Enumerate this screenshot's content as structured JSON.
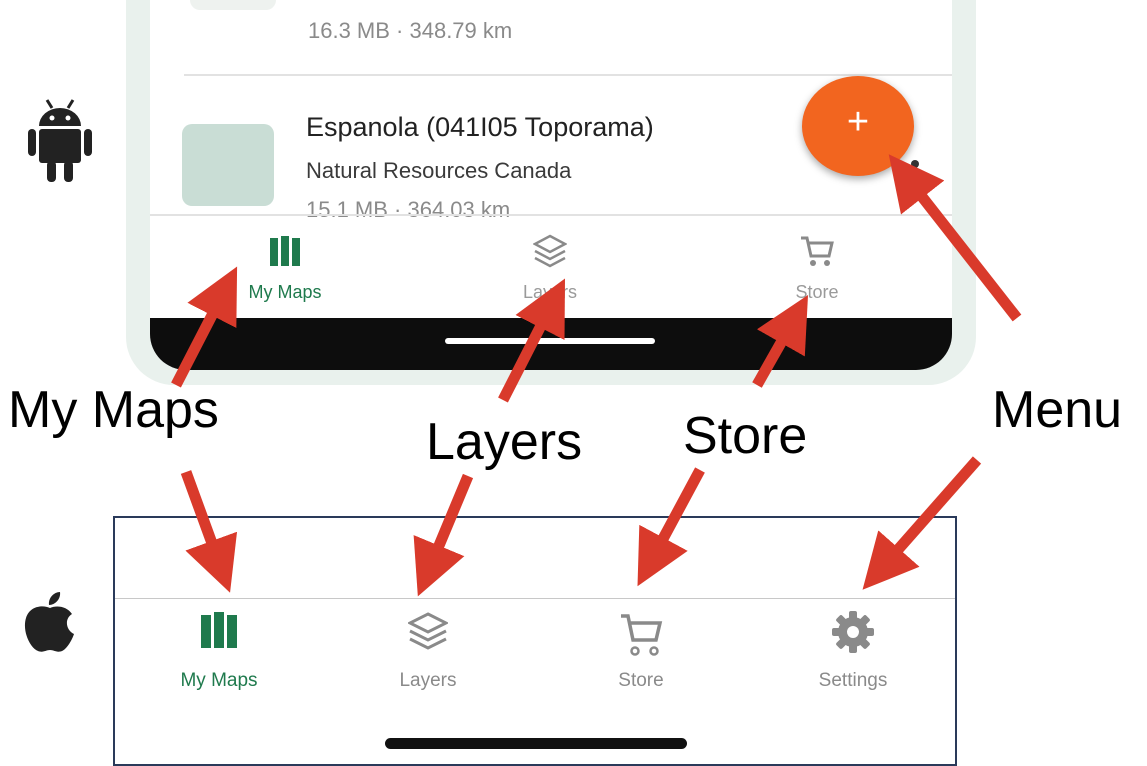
{
  "android": {
    "partial_item": {
      "meta": "16.3 MB · 348.79 km"
    },
    "item": {
      "title": "Espanola (041I05 Toporama)",
      "publisher": "Natural Resources Canada",
      "meta": "15.1 MB · 364.03 km"
    },
    "fab_symbol": "+",
    "nav": [
      {
        "label": "My Maps",
        "icon": "map-icon",
        "active": true
      },
      {
        "label": "Layers",
        "icon": "layers-icon",
        "active": false
      },
      {
        "label": "Store",
        "icon": "cart-icon",
        "active": false
      }
    ]
  },
  "ios": {
    "nav": [
      {
        "label": "My Maps",
        "icon": "map-icon",
        "active": true
      },
      {
        "label": "Layers",
        "icon": "layers-icon",
        "active": false
      },
      {
        "label": "Store",
        "icon": "cart-icon",
        "active": false
      },
      {
        "label": "Settings",
        "icon": "gear-icon",
        "active": false
      }
    ]
  },
  "callouts": {
    "my_maps": "My Maps",
    "layers": "Layers",
    "store": "Store",
    "menu": "Menu"
  },
  "colors": {
    "active_green": "#1f7a4d",
    "inactive_gray": "#8a8a8a",
    "fab_orange": "#f2651f",
    "arrow_red": "#d93a2b"
  },
  "platform_icons": [
    "android-icon",
    "apple-icon"
  ]
}
